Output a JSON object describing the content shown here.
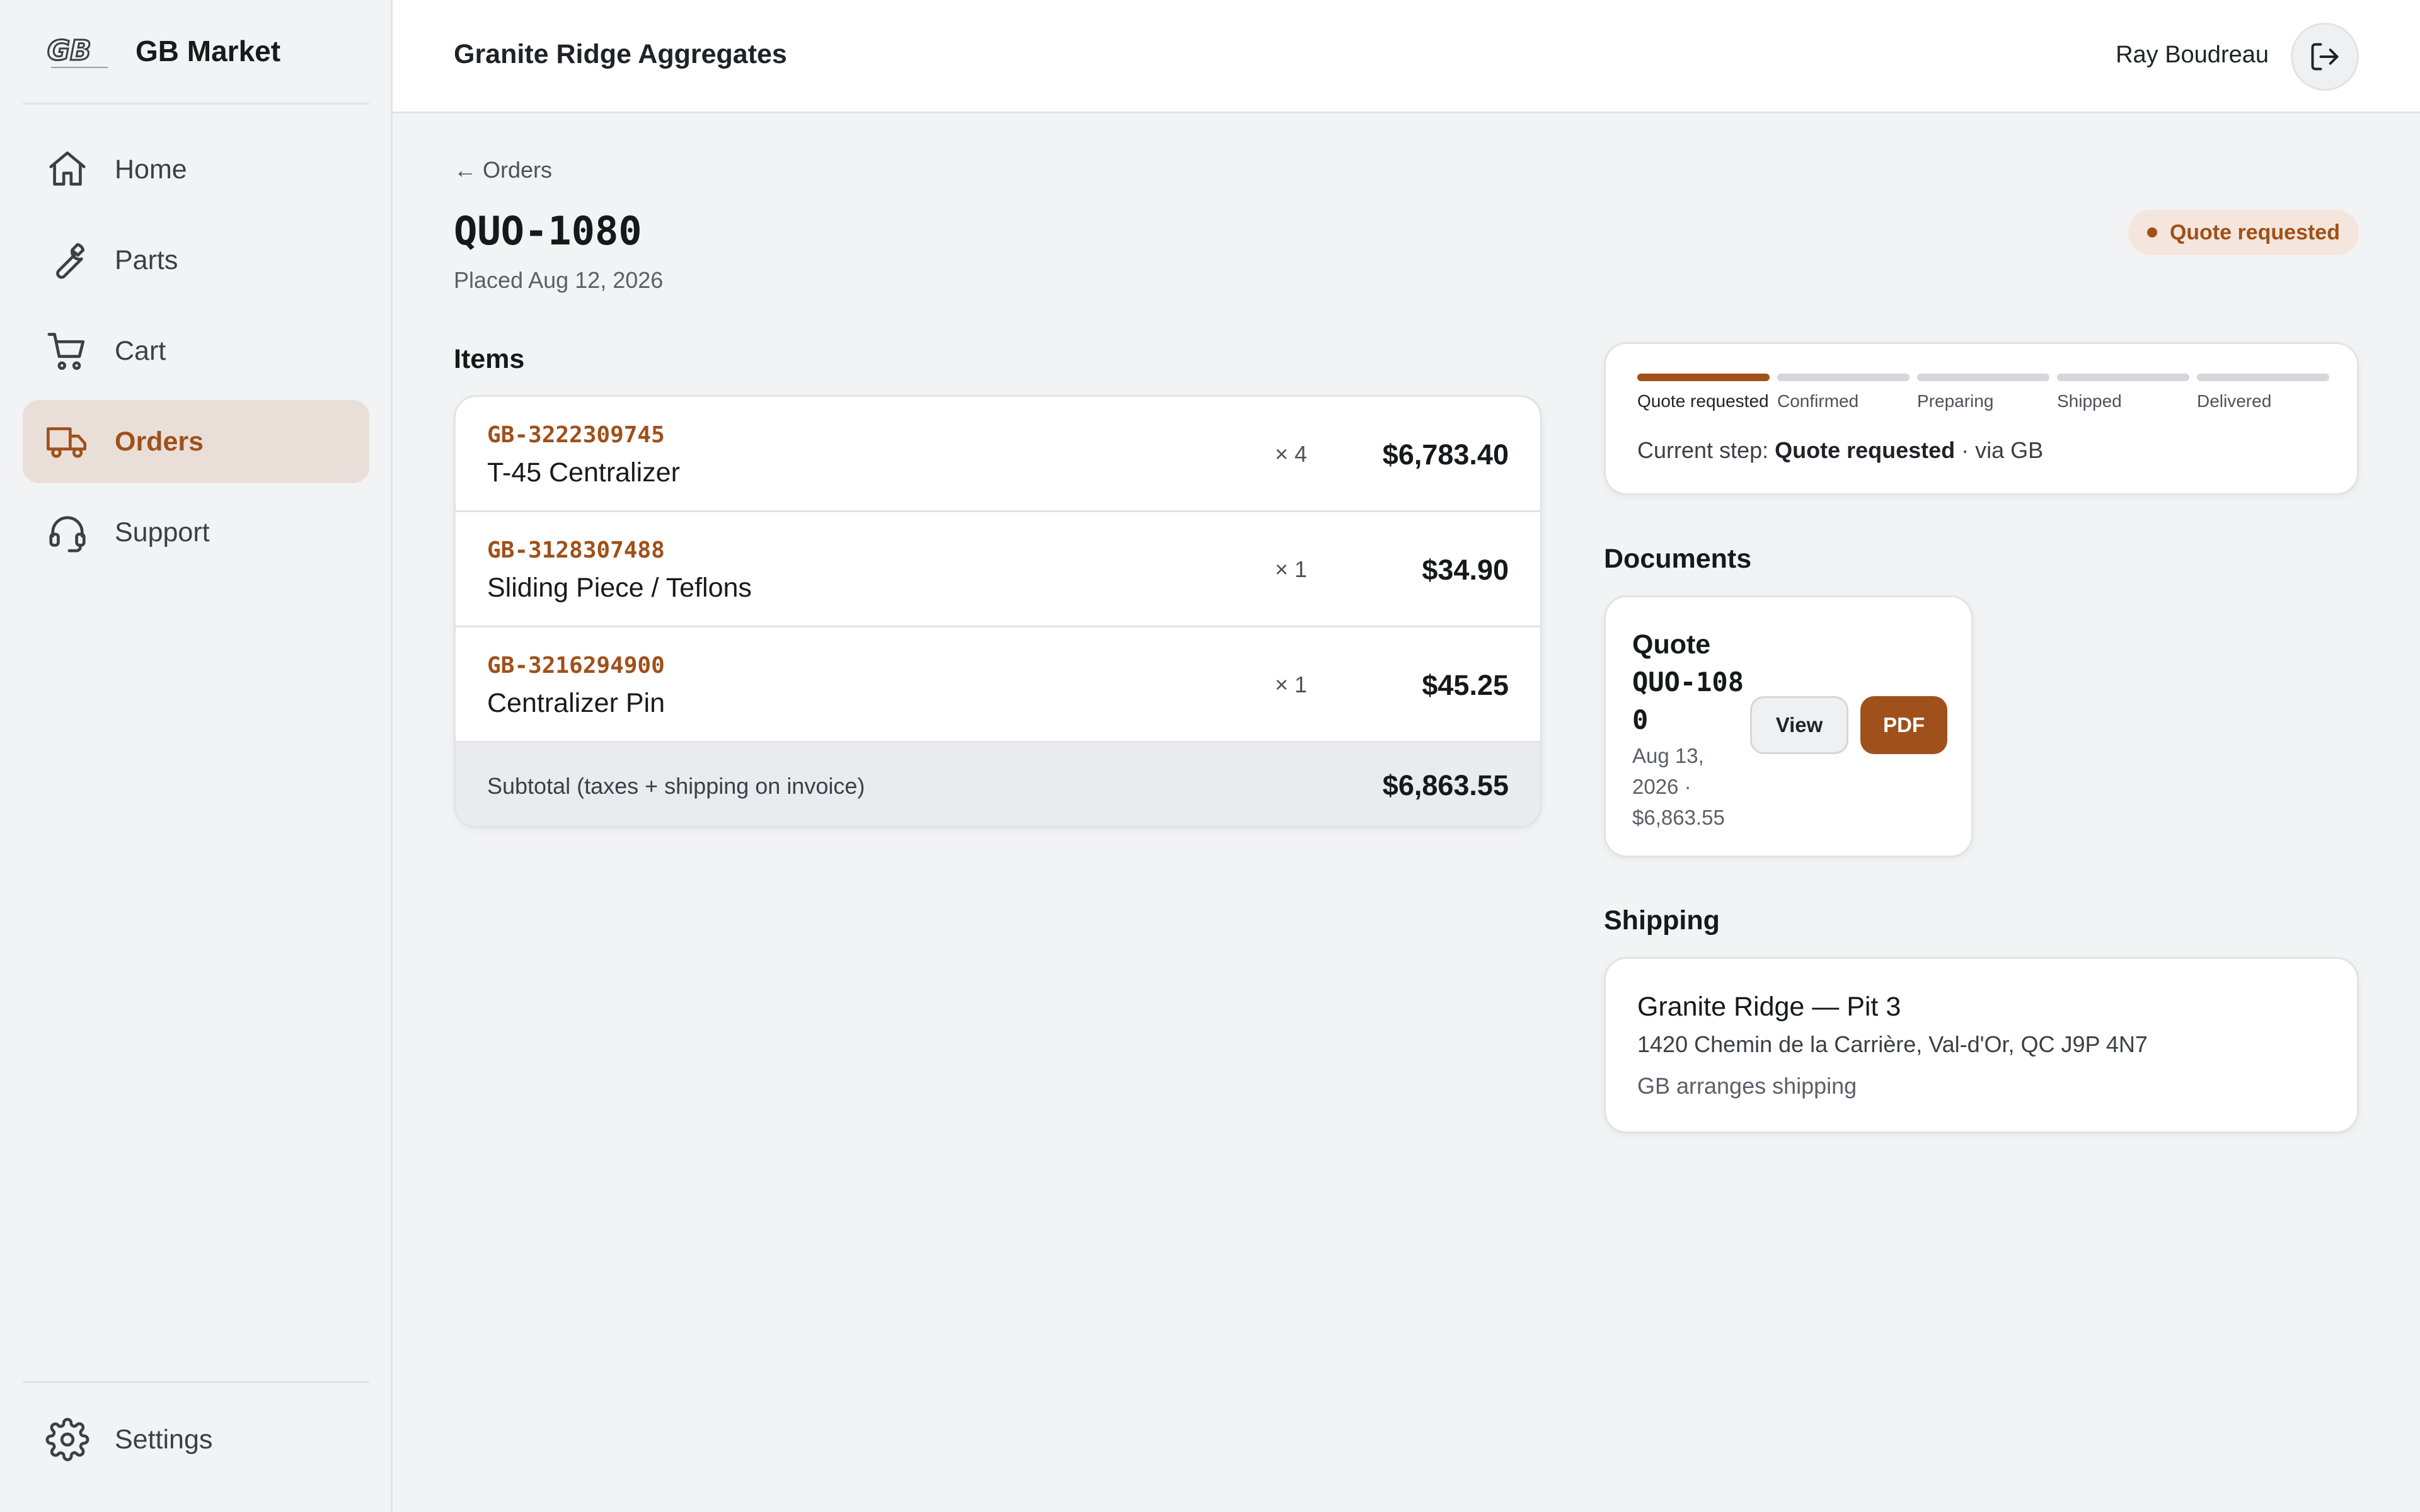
{
  "brand": {
    "name": "GB Market",
    "logo_text": "GB"
  },
  "sidebar": {
    "items": [
      {
        "label": "Home",
        "icon": "home-icon"
      },
      {
        "label": "Parts",
        "icon": "wrench-icon"
      },
      {
        "label": "Cart",
        "icon": "cart-icon"
      },
      {
        "label": "Orders",
        "icon": "truck-icon",
        "active": true
      },
      {
        "label": "Support",
        "icon": "headset-icon"
      }
    ],
    "settings": {
      "label": "Settings",
      "icon": "gear-icon"
    }
  },
  "header": {
    "company": "Granite Ridge Aggregates",
    "user_name": "Ray Boudreau",
    "logout_icon": "logout-icon"
  },
  "order": {
    "back_label": "← Orders",
    "id": "QUO-1080",
    "placed": "Placed Aug 12, 2026",
    "status": "Quote requested"
  },
  "items_section": {
    "title": "Items",
    "rows": [
      {
        "sku": "GB-3222309745",
        "name": "T-45 Centralizer",
        "qty": "× 4",
        "price": "$6,783.40"
      },
      {
        "sku": "GB-3128307488",
        "name": "Sliding Piece / Teflons",
        "qty": "× 1",
        "price": "$34.90"
      },
      {
        "sku": "GB-3216294900",
        "name": "Centralizer Pin",
        "qty": "× 1",
        "price": "$45.25"
      }
    ],
    "subtotal_label": "Subtotal (taxes + shipping on invoice)",
    "subtotal_value": "$6,863.55"
  },
  "progress": {
    "steps": [
      "Quote requested",
      "Confirmed",
      "Preparing",
      "Shipped",
      "Delivered"
    ],
    "completed_steps": 1,
    "current_prefix": "Current step: ",
    "current_step": "Quote requested",
    "current_suffix": " · via GB"
  },
  "documents": {
    "title": "Documents",
    "doc": {
      "title_line1": "Quote",
      "title_id": "QUO-1080",
      "meta": "Aug 13, 2026 · $6,863.55",
      "view_label": "View",
      "pdf_label": "PDF"
    }
  },
  "shipping": {
    "title": "Shipping",
    "name": "Granite Ridge — Pit 3",
    "address": "1420 Chemin de la Carrière, Val-d'Or, QC J9P 4N7",
    "method": "GB arranges shipping"
  },
  "colors": {
    "accent": "#a0501a",
    "accent_soft": "#eadfd8",
    "background": "#f2f3f5",
    "card": "#ffffff"
  }
}
